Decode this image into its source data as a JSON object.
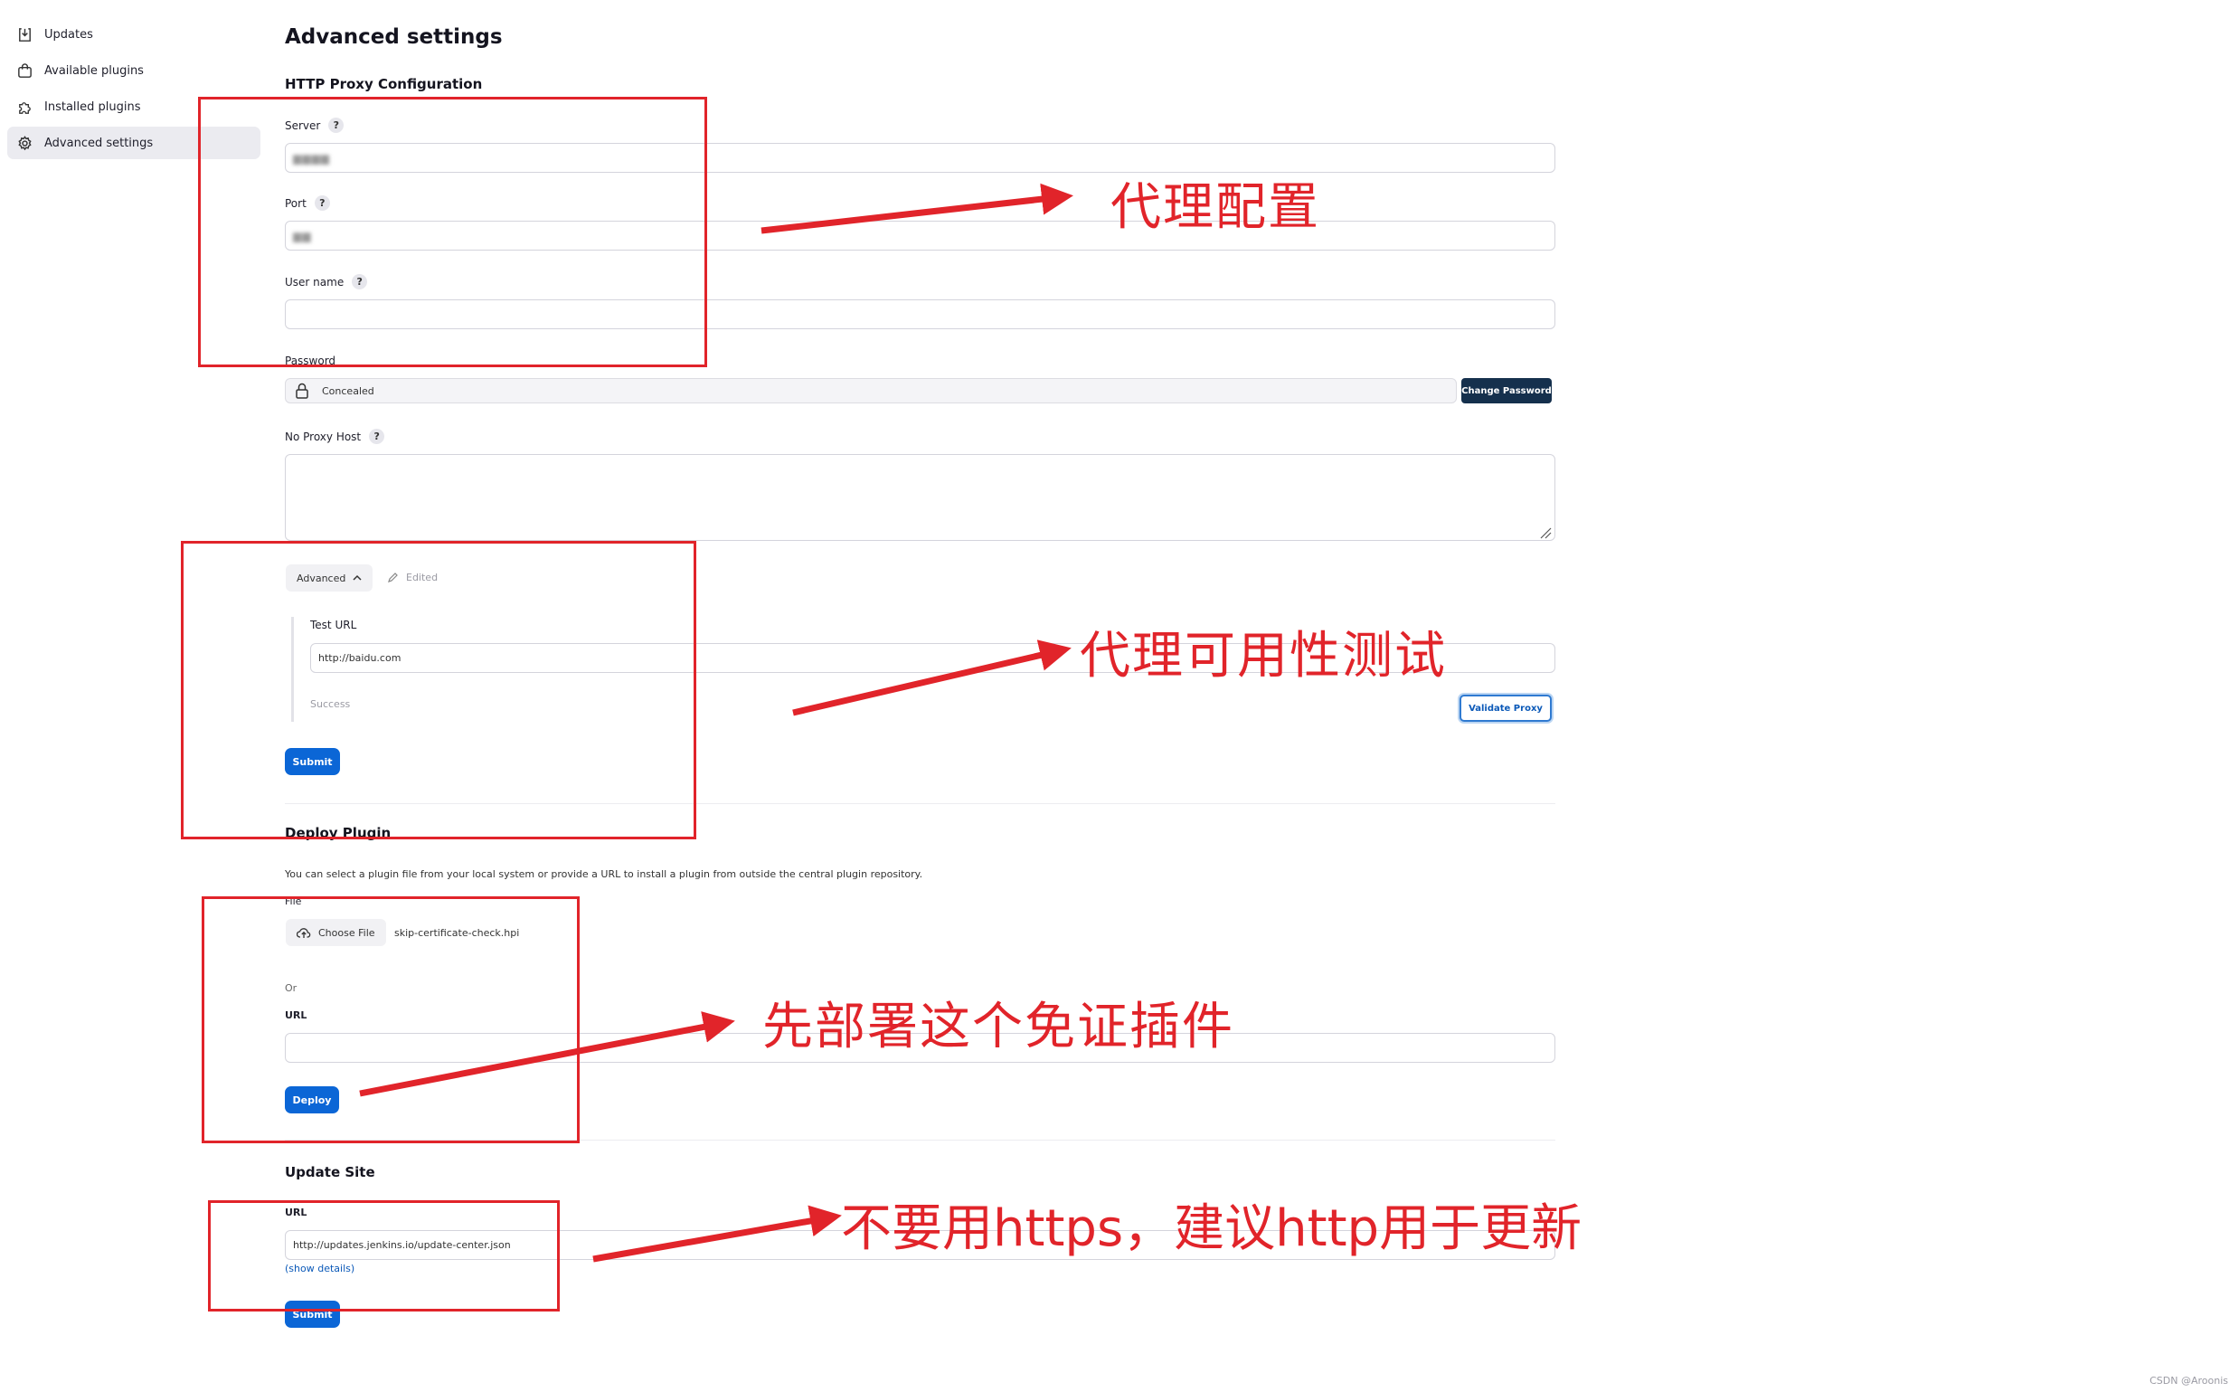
{
  "sidebar": {
    "items": [
      {
        "label": "Updates",
        "icon": "download-icon"
      },
      {
        "label": "Available plugins",
        "icon": "shopping-bag-icon"
      },
      {
        "label": "Installed plugins",
        "icon": "puzzle-icon"
      },
      {
        "label": "Advanced settings",
        "icon": "gear-icon",
        "active": true
      }
    ]
  },
  "page": {
    "title": "Advanced settings"
  },
  "proxy": {
    "section_title": "HTTP Proxy Configuration",
    "server_label": "Server",
    "port_label": "Port",
    "username_label": "User name",
    "password_label": "Password",
    "password_value": "Concealed",
    "change_password_label": "Change Password",
    "no_proxy_host_label": "No Proxy Host",
    "help_glyph": "?",
    "advanced_label": "Advanced",
    "edited_label": "Edited",
    "test_url_label": "Test URL",
    "test_url_value": "http://baidu.com",
    "status_text": "Success",
    "validate_label": "Validate Proxy",
    "submit_label": "Submit"
  },
  "deploy": {
    "section_title": "Deploy Plugin",
    "description": "You can select a plugin file from your local system or provide a URL to install a plugin from outside the central plugin repository.",
    "file_label": "File",
    "choose_file_label": "Choose File",
    "file_name": "skip-certificate-check.hpi",
    "or_label": "Or",
    "url_label": "URL",
    "deploy_label": "Deploy"
  },
  "update_site": {
    "section_title": "Update Site",
    "url_label": "URL",
    "url_value": "http://updates.jenkins.io/update-center.json",
    "show_details_label": "(show details)",
    "submit_label": "Submit"
  },
  "annotations": {
    "proxy_config": "代理配置",
    "proxy_test": "代理可用性测试",
    "deploy_plugin": "先部署这个免证插件",
    "update_site": "不要用https，建议http用于更新"
  },
  "watermark": "CSDN @Aroonis",
  "colors": {
    "annotation_red": "#e1242a",
    "primary_blue": "#0b66d6",
    "dark_button": "#15304d"
  }
}
